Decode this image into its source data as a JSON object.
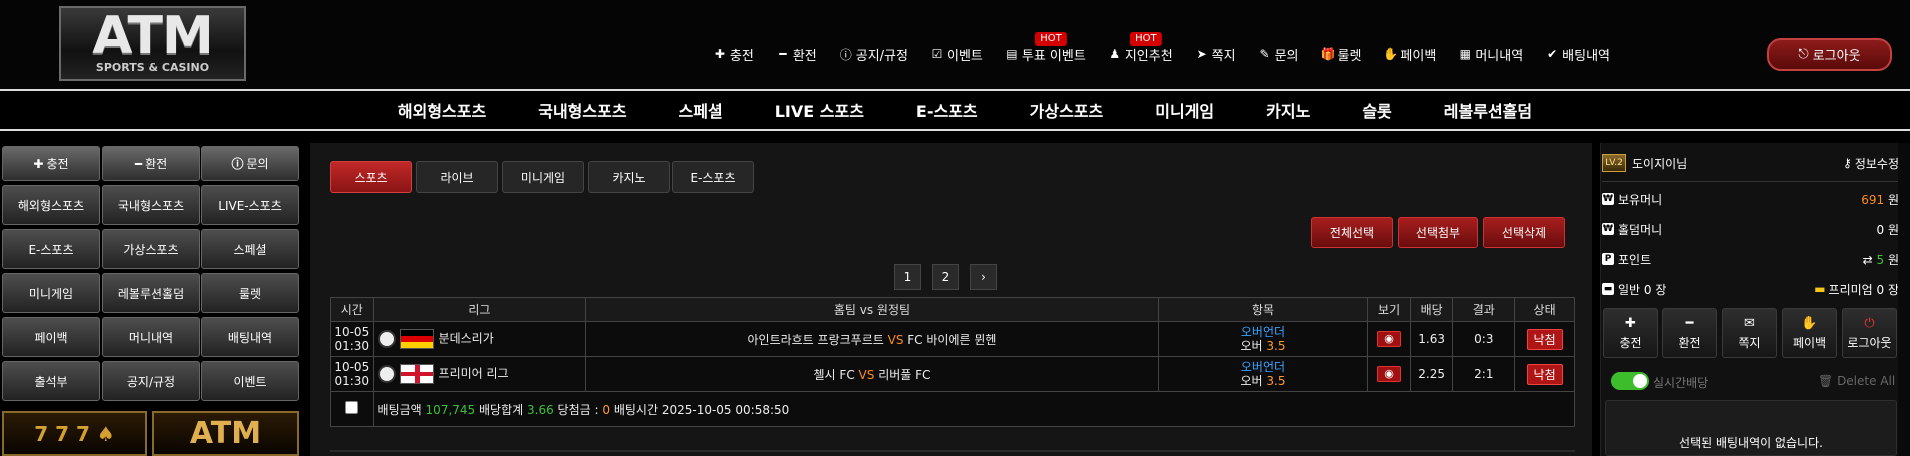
{
  "logo": {
    "big": "ATM",
    "small": "SPORTS & CASINO"
  },
  "topmenu": [
    {
      "icon": "plus-icon",
      "glyph": "✚",
      "label": "충전"
    },
    {
      "icon": "minus-icon",
      "glyph": "━",
      "label": "환전"
    },
    {
      "icon": "info-icon",
      "glyph": "ⓘ",
      "label": "공지/규정"
    },
    {
      "icon": "calendar-check-icon",
      "glyph": "☑",
      "label": "이벤트"
    },
    {
      "icon": "vote-icon",
      "glyph": "▤",
      "label": "투표 이벤트",
      "badge": "HOT"
    },
    {
      "icon": "user-icon",
      "glyph": "♟",
      "label": "지인추천",
      "badge": "HOT"
    },
    {
      "icon": "send-icon",
      "glyph": "➤",
      "label": "쪽지"
    },
    {
      "icon": "edit-icon",
      "glyph": "✎",
      "label": "문의"
    },
    {
      "icon": "gift-icon",
      "glyph": "🎁",
      "label": "룰렛"
    },
    {
      "icon": "hand-coin-icon",
      "glyph": "✋",
      "label": "페이백"
    },
    {
      "icon": "clipboard-icon",
      "glyph": "▦",
      "label": "머니내역"
    },
    {
      "icon": "check-icon",
      "glyph": "✔",
      "label": "배팅내역"
    }
  ],
  "logout_top": {
    "glyph": "⎋",
    "label": "로그아웃"
  },
  "mainnav": [
    "해외형스포츠",
    "국내형스포츠",
    "스페셜",
    "LIVE 스포츠",
    "E-스포츠",
    "가상스포츠",
    "미니게임",
    "카지노",
    "슬롯",
    "레볼루션홀덤"
  ],
  "leftbar": {
    "top": [
      {
        "glyph": "✚",
        "label": "충전"
      },
      {
        "glyph": "━",
        "label": "환전"
      },
      {
        "glyph": "ⓘ",
        "label": "문의"
      }
    ],
    "grid": [
      "해외형스포츠",
      "국내형스포츠",
      "LIVE-스포츠",
      "E-스포츠",
      "가상스포츠",
      "스페셜",
      "미니게임",
      "레볼루션홀덤",
      "룰렛",
      "페이백",
      "머니내역",
      "배팅내역",
      "출석부",
      "공지/규정",
      "이벤트"
    ],
    "banner_right": "ATM"
  },
  "tabs": [
    "스포츠",
    "라이브",
    "미니게임",
    "카지노",
    "E-스포츠"
  ],
  "actions": [
    "전체선택",
    "선택첨부",
    "선택삭제"
  ],
  "pages": [
    "1",
    "2",
    "›"
  ],
  "table": {
    "headers": [
      "시간",
      "리그",
      "홈팀 vs 원정팀",
      "항목",
      "보기",
      "배당",
      "결과",
      "상태"
    ],
    "rows": [
      {
        "date": "10-05",
        "time": "01:30",
        "flag": "de",
        "league": "분데스리가",
        "home": "아인트라흐트 프랑크푸르트",
        "vs": "VS",
        "away": "FC 바이에른 뮌헨",
        "item_top": "오버언더",
        "item_bottom": "오버",
        "line": "3.5",
        "odds": "1.63",
        "result": "0:3",
        "status": "낙첨"
      },
      {
        "date": "10-05",
        "time": "01:30",
        "flag": "en",
        "league": "프리미어 리그",
        "home": "첼시 FC",
        "vs": "VS",
        "away": "리버풀 FC",
        "item_top": "오버언더",
        "item_bottom": "오버",
        "line": "3.5",
        "odds": "2.25",
        "result": "2:1",
        "status": "낙첨"
      }
    ],
    "summary": {
      "bet_label": "배팅금액",
      "bet_value": "107,745",
      "total_label": "배당합계",
      "total_value": "3.66",
      "win_label": "당첨금 :",
      "win_value": "0",
      "time_label": "배팅시간",
      "time_value": "2025-10-05 00:58:50"
    }
  },
  "rightbar": {
    "level": "LV.2",
    "username": "도이지이님",
    "edit_label": "정보수정",
    "money_label": "보유머니",
    "money_value": "691",
    "money_unit": "원",
    "holdem_label": "홀덤머니",
    "holdem_value": "0",
    "holdem_unit": "원",
    "point_label": "포인트",
    "point_value": "5",
    "point_unit": "원",
    "normal_label": "일반 0 장",
    "premium_label": "프리미엄 0 장",
    "buttons": [
      {
        "glyph": "✚",
        "label": "충전"
      },
      {
        "glyph": "━",
        "label": "환전"
      },
      {
        "glyph": "✉",
        "label": "쪽지"
      },
      {
        "glyph": "✋",
        "label": "페이백"
      },
      {
        "glyph": "⏻",
        "label": "로그아웃"
      }
    ],
    "realtime_label": "실시간배당",
    "delete_all_label": "Delete All",
    "empty_label": "선택된 배팅내역이 없습니다."
  },
  "colors": {
    "accent_red": "#b01515",
    "odds_green": "#39c13a",
    "line_orange": "#ff9a2e",
    "item_blue": "#3aa3ff",
    "money_orange": "#ff8c1a"
  }
}
